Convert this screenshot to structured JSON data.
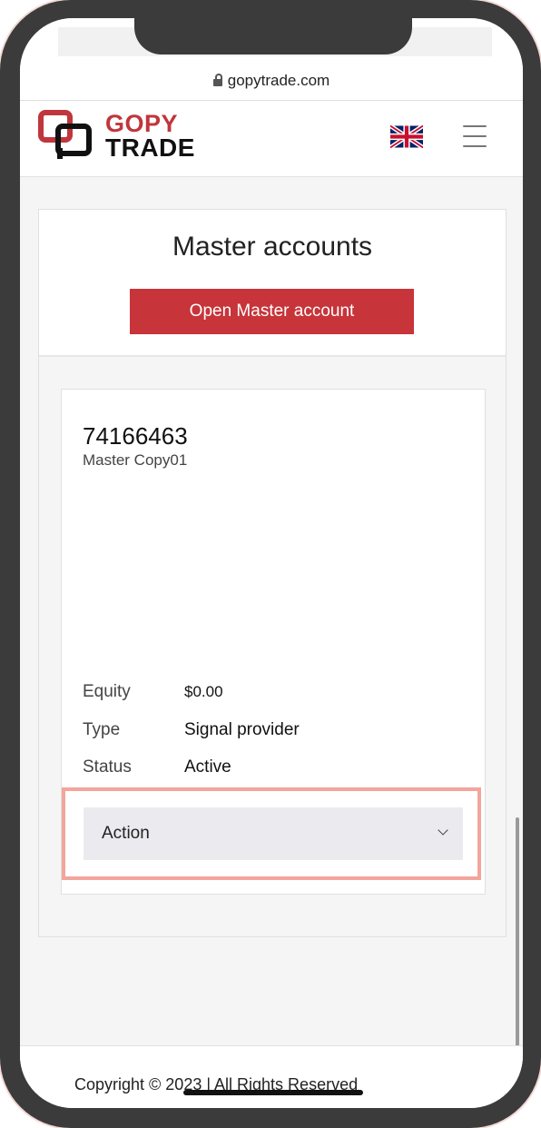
{
  "browser": {
    "url": "gopytrade.com"
  },
  "header": {
    "logo_line1": "GOPY",
    "logo_line2": "TRADE",
    "language_flag_icon": "uk-flag-icon",
    "menu_icon": "hamburger-menu-icon"
  },
  "page": {
    "title": "Master accounts",
    "open_button_label": "Open Master account"
  },
  "account": {
    "number": "74166463",
    "name": "Master Copy01",
    "fields": [
      {
        "label": "Equity",
        "value": "$0.00"
      },
      {
        "label": "Type",
        "value": "Signal provider"
      },
      {
        "label": "Status",
        "value": "Active"
      }
    ],
    "action_label": "Action"
  },
  "footer": {
    "copyright": "Copyright © 2023 | All Rights Reserved"
  },
  "colors": {
    "brand_red": "#c7343a",
    "highlight": "#f3a59c"
  }
}
